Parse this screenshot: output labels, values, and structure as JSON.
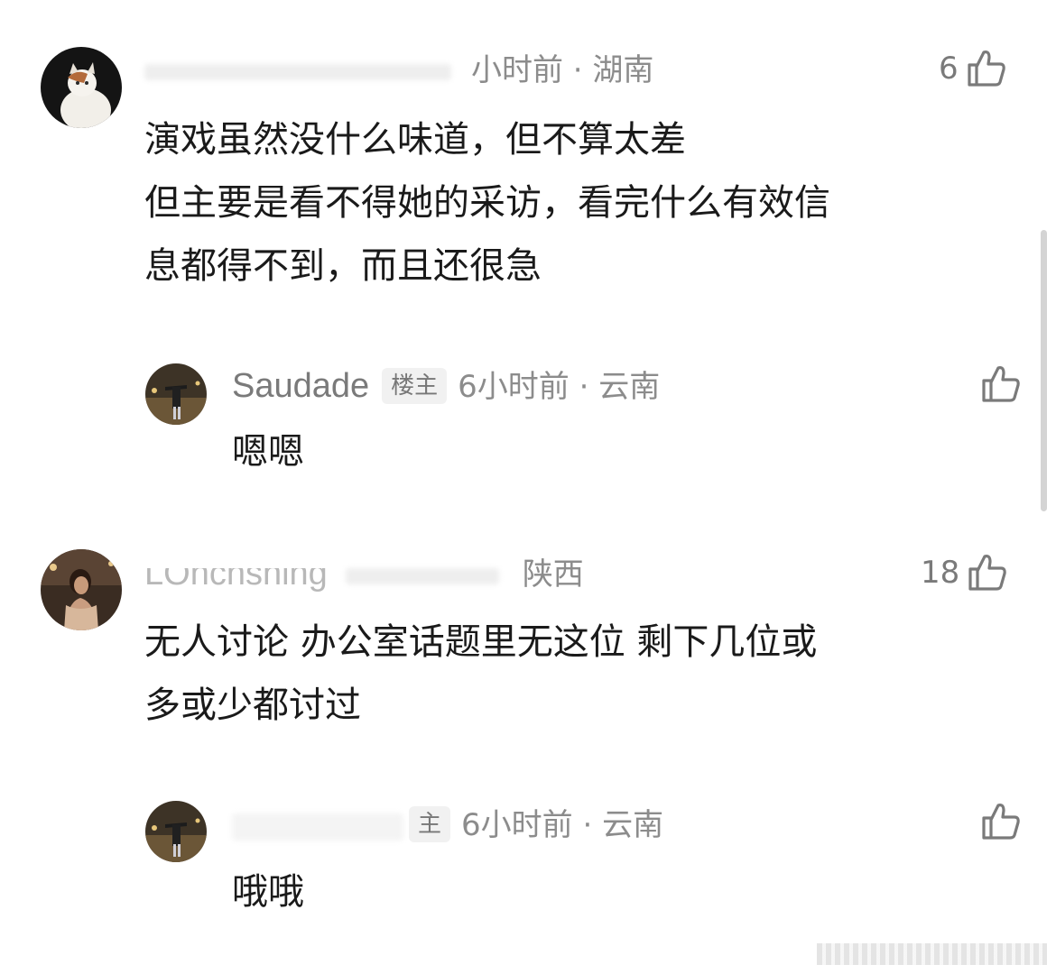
{
  "comments": [
    {
      "time_location": "小时前 · 湖南",
      "content_lines": [
        "演戏虽然没什么味道，但不算太差",
        "但主要是看不得她的采访，看完什么有效信",
        "息都得不到，而且还很急"
      ],
      "like_count": "6",
      "reply": {
        "username": "Saudade",
        "badge": "楼主",
        "time_location": "6小时前 · 云南",
        "content": "嗯嗯"
      }
    },
    {
      "username_partial": "LOncnshing",
      "time_location": "陕西",
      "content_lines": [
        "无人讨论 办公室话题里无这位  剩下几位或",
        "多或少都讨过"
      ],
      "like_count": "18",
      "reply": {
        "badge_partial": "主",
        "time_location": "6小时前 · 云南",
        "content": "哦哦"
      }
    }
  ],
  "icons": {
    "like": "thumbs-up-icon"
  },
  "colors": {
    "text": "#1a1a1a",
    "meta": "#8c8c8c",
    "icon": "#7a7a7a",
    "badge_bg": "#f1f1f1"
  }
}
